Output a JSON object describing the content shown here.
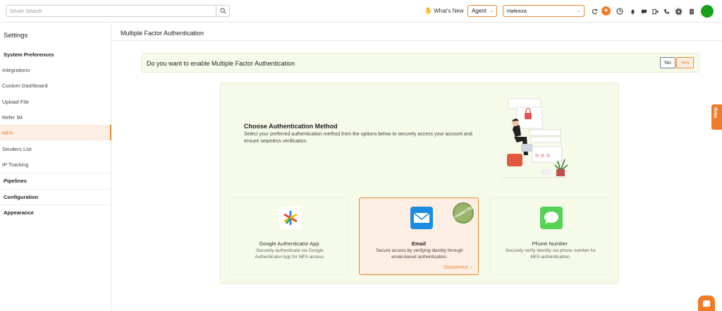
{
  "topbar": {
    "search_placeholder": "Smart Search",
    "whats_new": "What's New",
    "agent_label": "Agent",
    "user_label": "Hafeeza"
  },
  "sidebar": {
    "title": "Settings",
    "items": [
      {
        "label": "System Preferences"
      },
      {
        "label": "Integrations"
      },
      {
        "label": "Custom Dashboard"
      },
      {
        "label": "Upload File"
      },
      {
        "label": "Refer IM"
      },
      {
        "label": "MFA"
      },
      {
        "label": "Senders List"
      },
      {
        "label": "IP Tracking"
      },
      {
        "label": "Pipelines"
      },
      {
        "label": "Configuration"
      },
      {
        "label": "Appearance"
      }
    ]
  },
  "page": {
    "title": "Multiple Factor Authentication",
    "question": "Do you want to enable Multiple Factor Authentication",
    "no_label": "No",
    "yes_label": "Yes"
  },
  "method": {
    "title": "Choose Authentication Method",
    "description": "Select your preferred authentication method from the options below to securely access your account and ensure seamless verification."
  },
  "cards": {
    "google": {
      "title": "Google Authenticator App",
      "description": "Securely authenticate via Google Authenticator App for MFA access."
    },
    "email": {
      "title": "Email",
      "description": "Secure access by verifying identity through email-based authentication.",
      "stamp": "CONNECTED",
      "action": "Disconnect"
    },
    "phone": {
      "title": "Phone Number",
      "description": "Securely verify identity via phone number for MFA authentication."
    }
  },
  "help": {
    "label": "Help"
  },
  "colors": {
    "accent": "#e8892f",
    "panel": "#f6fbe9",
    "avatar": "#1aa11a"
  }
}
